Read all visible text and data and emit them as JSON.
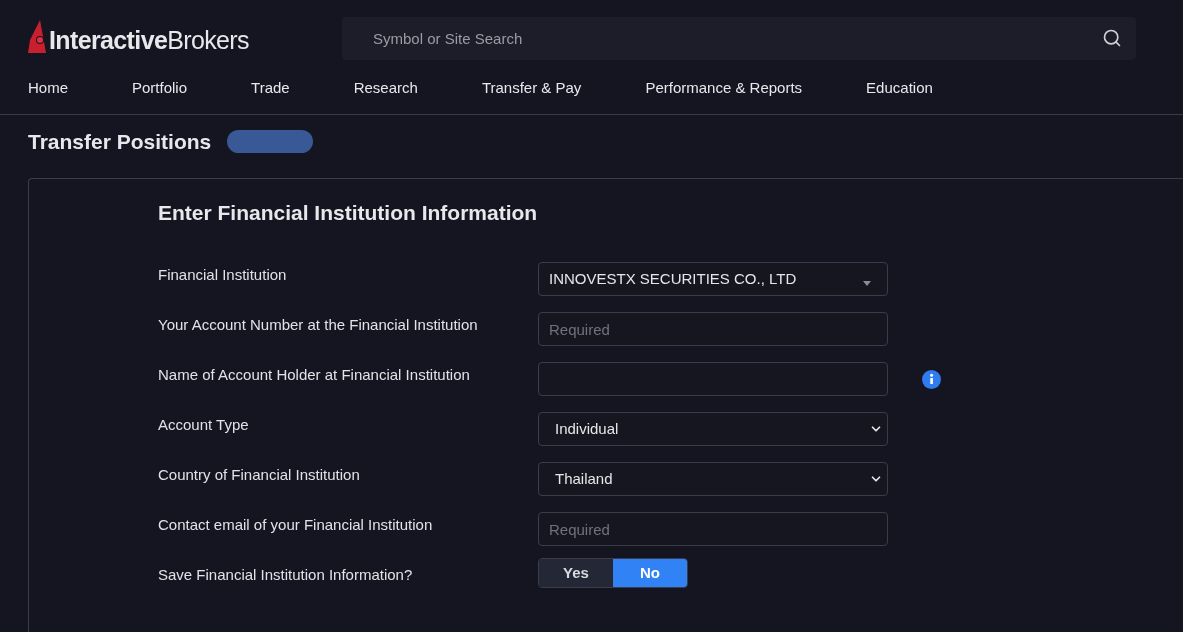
{
  "logo": {
    "text": "**Interactive**Brokers"
  },
  "search": {
    "placeholder": "Symbol or Site Search"
  },
  "nav": [
    {
      "label": "Home"
    },
    {
      "label": "Portfolio"
    },
    {
      "label": "Trade"
    },
    {
      "label": "Research"
    },
    {
      "label": "Transfer & Pay"
    },
    {
      "label": "Performance & Reports"
    },
    {
      "label": "Education"
    }
  ],
  "page": {
    "title": "Transfer Positions"
  },
  "form": {
    "title": "Enter Financial Institution Information",
    "fields": [
      {
        "label": "Financial Institution",
        "kind": "combo",
        "value": "INNOVESTX SECURITIES CO., LTD"
      },
      {
        "label": "Your Account Number at the Financial Institution",
        "kind": "input",
        "placeholder": "Required"
      },
      {
        "label": "Name of Account Holder at Financial Institution",
        "kind": "input",
        "info": true
      },
      {
        "label": "Account Type",
        "kind": "select",
        "value": "Individual"
      },
      {
        "label": "Country of Financial Institution",
        "kind": "select",
        "value": "Thailand"
      },
      {
        "label": "Contact email of your Financial Institution",
        "kind": "input",
        "placeholder": "Required"
      },
      {
        "label": "Save Financial Institution Information?",
        "kind": "toggle",
        "options": [
          {
            "label": "Yes",
            "selected": false
          },
          {
            "label": "No",
            "selected": true
          }
        ]
      }
    ]
  }
}
